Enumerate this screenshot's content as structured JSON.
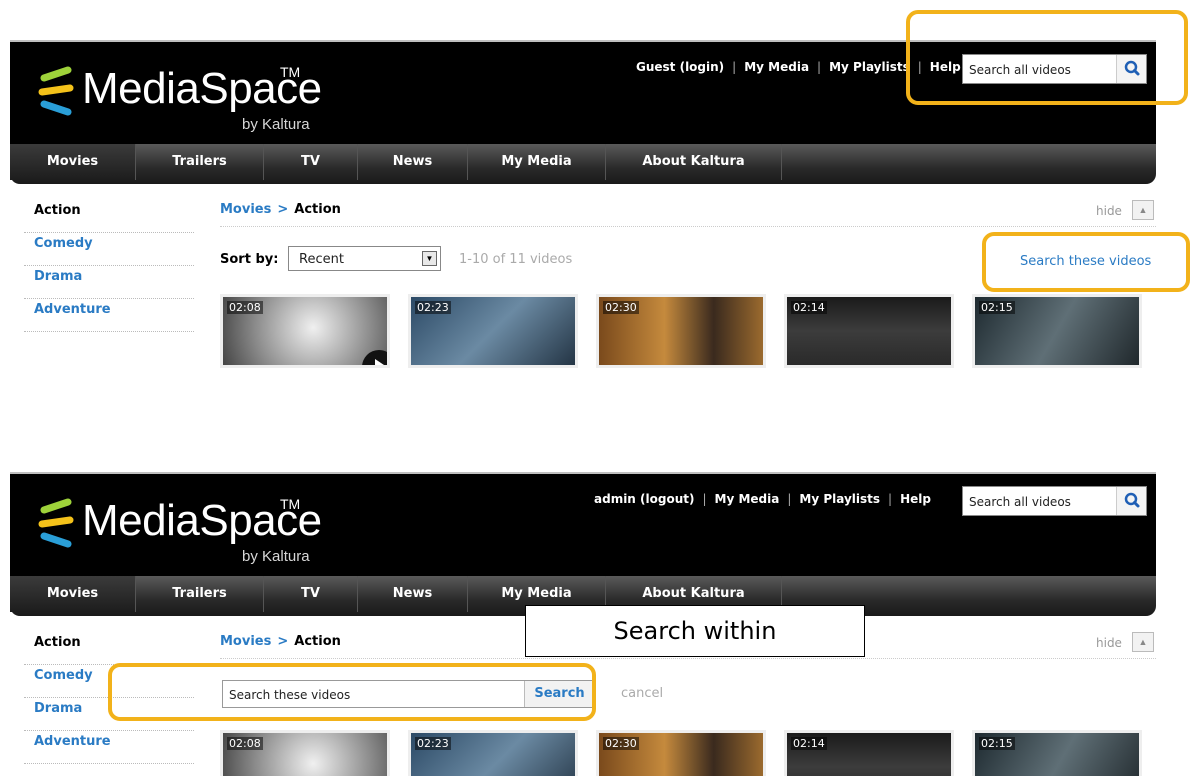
{
  "brand": {
    "name": "MediaSpace",
    "tm": "TM",
    "sub": "by Kaltura"
  },
  "nav": [
    "Movies",
    "Trailers",
    "TV",
    "News",
    "My Media",
    "About Kaltura"
  ],
  "sidebar": [
    "Action",
    "Comedy",
    "Drama",
    "Adventure"
  ],
  "breadcrumb": {
    "parent": "Movies",
    "sep": ">",
    "current": "Action"
  },
  "hide_label": "hide",
  "search_all_placeholder": "Search all videos",
  "durations": [
    "02:08",
    "02:23",
    "02:30",
    "02:14",
    "02:15"
  ],
  "panel1": {
    "user_link": "Guest (login)",
    "top_links": [
      "My Media",
      "My Playlists",
      "Help"
    ],
    "sort_label": "Sort by:",
    "sort_value": "Recent",
    "count": "1-10 of 11 videos",
    "search_these": "Search these videos"
  },
  "panel2": {
    "user_link": "admin (logout)",
    "top_links": [
      "My Media",
      "My Playlists",
      "Help"
    ],
    "inline_search_value": "Search these videos",
    "inline_search_button": "Search",
    "cancel": "cancel"
  },
  "callout": "Search within",
  "colors": {
    "highlight": "#f2b21a",
    "link": "#2a7bc4"
  }
}
